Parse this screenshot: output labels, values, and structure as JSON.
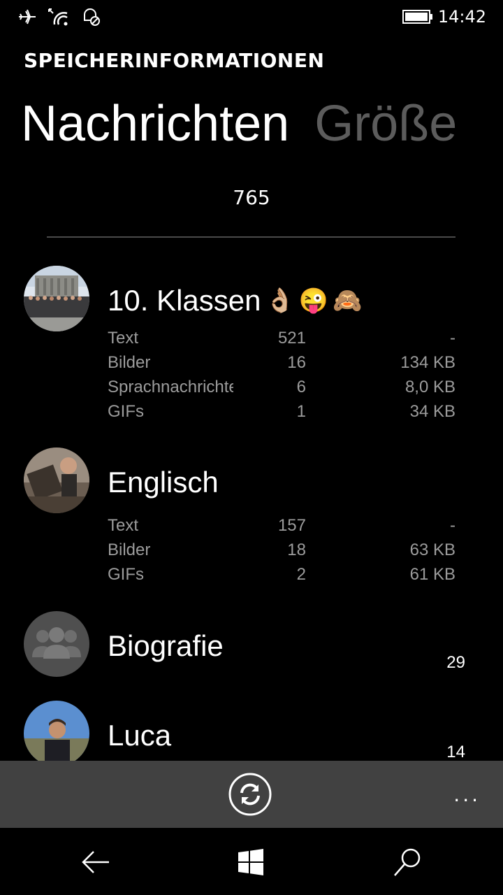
{
  "status_bar": {
    "time": "14:42",
    "icons": [
      "airplane-icon",
      "wifi-icon",
      "quiet-hours-icon",
      "battery-icon"
    ]
  },
  "app": {
    "title": "SPEICHERINFORMATIONEN"
  },
  "pivot": {
    "tabs": [
      {
        "label": "Nachrichten",
        "active": true
      },
      {
        "label": "Größe",
        "active": false
      }
    ]
  },
  "total_count": "765",
  "chats": [
    {
      "name": "10. Klassen",
      "emojis": [
        "👌🏼",
        "😜",
        "🙈"
      ],
      "avatar": "group-photo",
      "rows": [
        {
          "label": "Text",
          "count": "521",
          "size": "-"
        },
        {
          "label": "Bilder",
          "count": "16",
          "size": "134 KB"
        },
        {
          "label": "Sprachnachrichten",
          "count": "6",
          "size": "8,0 KB"
        },
        {
          "label": "GIFs",
          "count": "1",
          "size": "34 KB"
        }
      ]
    },
    {
      "name": "Englisch",
      "avatar": "photo",
      "rows": [
        {
          "label": "Text",
          "count": "157",
          "size": "-"
        },
        {
          "label": "Bilder",
          "count": "18",
          "size": "63 KB"
        },
        {
          "label": "GIFs",
          "count": "2",
          "size": "61 KB"
        }
      ]
    },
    {
      "name": "Biografie",
      "avatar": "group-placeholder",
      "count": "29"
    },
    {
      "name": "Luca",
      "avatar": "photo",
      "count": "14"
    }
  ],
  "app_bar": {
    "sync_icon": "sync-icon",
    "more_label": "..."
  },
  "nav_bar": {
    "icons": [
      "back-icon",
      "windows-icon",
      "search-icon"
    ]
  },
  "colors": {
    "background": "#000000",
    "inactive_tab": "#5c5c5c",
    "secondary_text": "#9c9c9c",
    "app_bar": "#414141"
  }
}
